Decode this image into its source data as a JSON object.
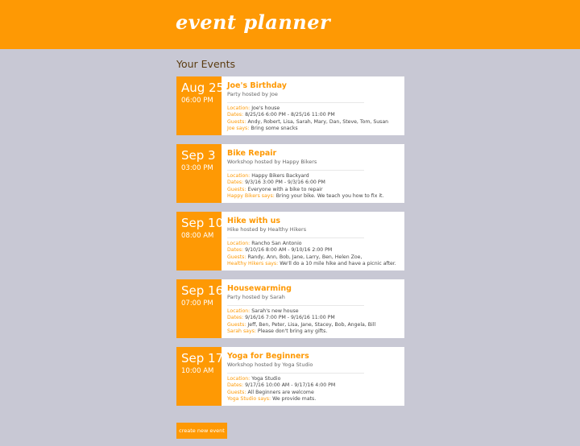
{
  "header": {
    "logo_text": "event planner"
  },
  "section_title": "Your Events",
  "events": [
    {
      "date": "Aug 25",
      "time": "06:00 PM",
      "title": "Joe's Birthday",
      "subtitle": "Party hosted by Joe",
      "location_label": "Location:",
      "location": "Joe's house",
      "dates_label": "Dates:",
      "dates": "8/25/16 6:00 PM - 8/25/16 11:00 PM",
      "guests_label": "Guests:",
      "guests": "Andy, Robert, Lisa, Sarah, Mary, Dan, Steve, Tom, Susan",
      "says_label": "Joe says:",
      "says": "Bring some snacks"
    },
    {
      "date": "Sep 3",
      "time": "03:00 PM",
      "title": "Bike Repair",
      "subtitle": "Workshop hosted by Happy Bikers",
      "location_label": "Location:",
      "location": "Happy Bikers Backyard",
      "dates_label": "Dates:",
      "dates": "9/3/16 3:00 PM - 9/3/16 6:00 PM",
      "guests_label": "Guests:",
      "guests": "Everyone with a bike to repair",
      "says_label": "Happy Bikers says:",
      "says": "Bring your bike. We teach you how to fix it."
    },
    {
      "date": "Sep 10",
      "time": "08:00 AM",
      "title": "Hike with us",
      "subtitle": "Hike hosted by Healthy Hikers",
      "location_label": "Location:",
      "location": "Rancho San Antonio",
      "dates_label": "Dates:",
      "dates": "9/10/16 8:00 AM - 9/10/16 2:00 PM",
      "guests_label": "Guests:",
      "guests": "Randy, Ann, Bob, Jane, Larry, Ben, Helen Zoe,",
      "says_label": "Healthy Hikers says:",
      "says": "We'll do a 10 mile hike and have a picnic after."
    },
    {
      "date": "Sep 16",
      "time": "07:00 PM",
      "title": "Housewarming",
      "subtitle": "Party hosted by Sarah",
      "location_label": "Location:",
      "location": "Sarah's new house",
      "dates_label": "Dates:",
      "dates": "9/16/16 7:00 PM - 9/16/16 11:00 PM",
      "guests_label": "Guests:",
      "guests": "Jeff, Ben, Peter, Lisa, Jane, Stacey, Bob, Angela, Bill",
      "says_label": "Sarah says:",
      "says": "Please don't bring any gifts."
    },
    {
      "date": "Sep 17",
      "time": "10:00 AM",
      "title": "Yoga for Beginners",
      "subtitle": "Workshop hosted by Yoga Studio",
      "location_label": "Location:",
      "location": "Yoga Studio",
      "dates_label": "Dates:",
      "dates": "9/17/16 10:00 AM - 9/17/16 4:00 PM",
      "guests_label": "Guests:",
      "guests": "All Beginners are welcome",
      "says_label": "Yoga Studio says:",
      "says": "We provide mats."
    }
  ],
  "create_button_label": "create new event",
  "colors": {
    "accent": "#fe9904",
    "background": "#c8c8d4",
    "card": "#ffffff"
  }
}
